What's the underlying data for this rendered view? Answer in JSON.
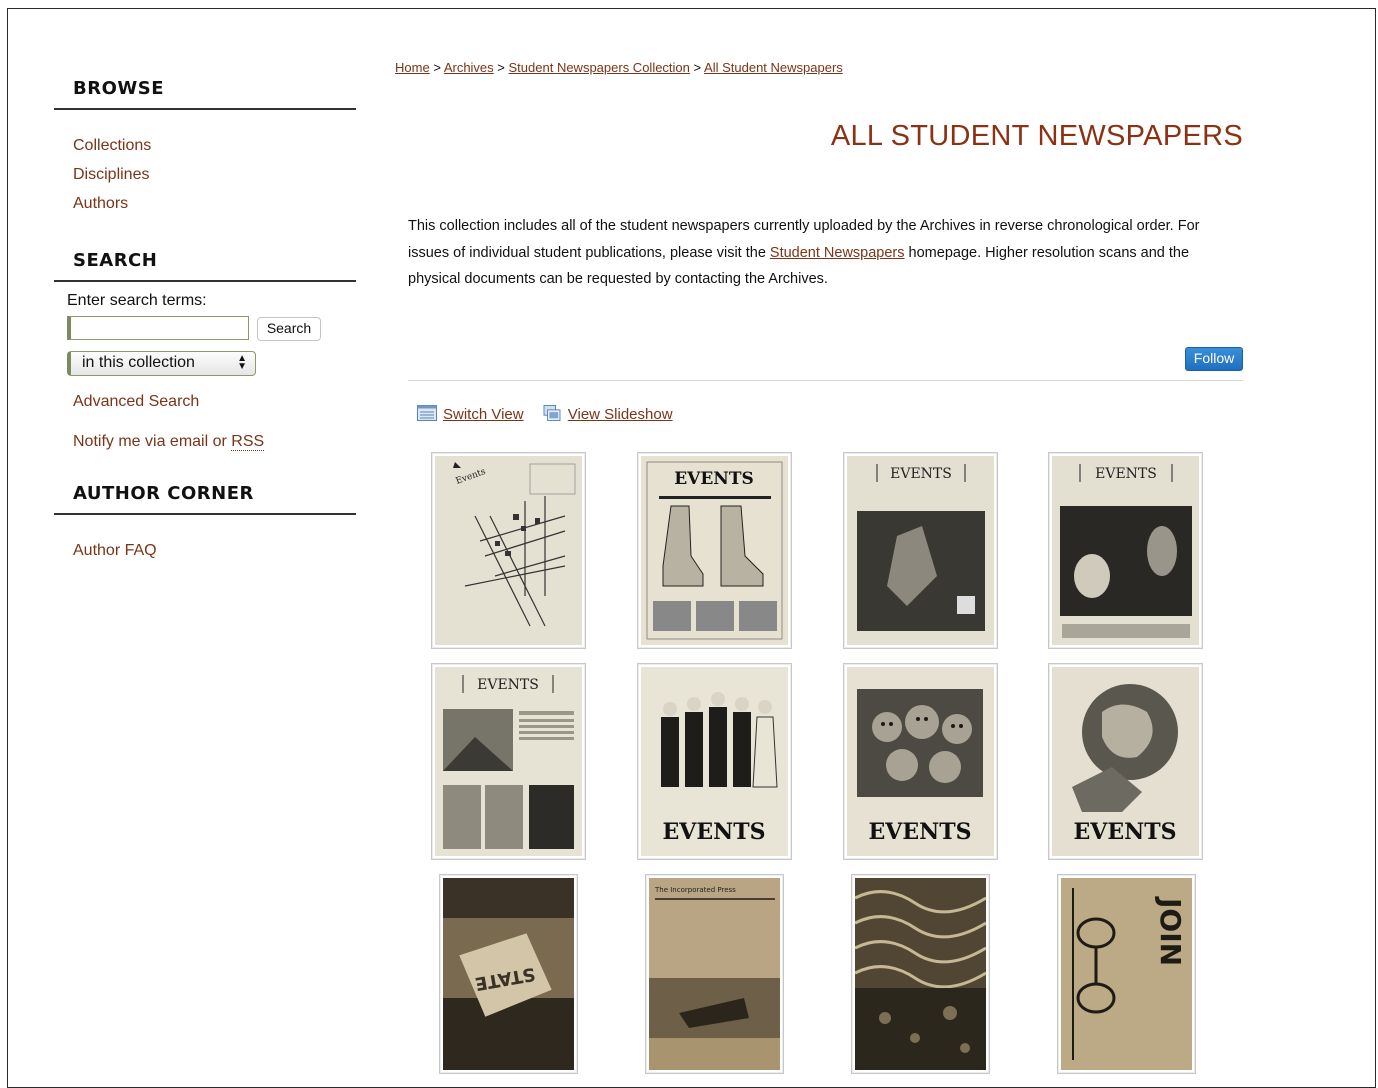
{
  "sidebar": {
    "browse": {
      "heading": "BROWSE",
      "items": [
        {
          "label": "Collections"
        },
        {
          "label": "Disciplines"
        },
        {
          "label": "Authors"
        }
      ]
    },
    "search": {
      "heading": "SEARCH",
      "label": "Enter search terms:",
      "input_value": "",
      "button_label": "Search",
      "scope_selected": "in this collection",
      "advanced_label": "Advanced Search",
      "notify_prefix": "Notify me via email or ",
      "notify_rss": "RSS"
    },
    "author_corner": {
      "heading": "AUTHOR CORNER",
      "items": [
        {
          "label": "Author FAQ"
        }
      ]
    }
  },
  "breadcrumb": {
    "items": [
      "Home",
      "Archives",
      "Student Newspapers Collection",
      "All Student Newspapers"
    ],
    "separator": ">"
  },
  "page_title": "ALL STUDENT NEWSPAPERS",
  "intro": {
    "part1": "This collection includes all of the student newspapers currently uploaded by the Archives in reverse chronological order. For issues of individual student publications, please visit the ",
    "link": "Student Newspapers",
    "part2": " homepage. Higher resolution scans and the physical documents can be requested by contacting the Archives."
  },
  "follow_label": "Follow",
  "view_links": {
    "switch_view": "Switch View",
    "slideshow": "View Slideshow"
  },
  "thumbnails": [
    {
      "icon": "events-map-cover-icon",
      "caption": "Events"
    },
    {
      "icon": "events-boots-cover-icon",
      "caption": "EVENTS"
    },
    {
      "icon": "events-february-march-cover-icon",
      "caption": "EVENTS"
    },
    {
      "icon": "events-february-cover-icon",
      "caption": "EVENTS"
    },
    {
      "icon": "events-january-february-cover-icon",
      "caption": "EVENTS"
    },
    {
      "icon": "events-figures-cover-icon",
      "caption": "EVENTS"
    },
    {
      "icon": "events-faces-cover-icon",
      "caption": "EVENTS"
    },
    {
      "icon": "events-globe-cover-icon",
      "caption": "EVENTS"
    },
    {
      "icon": "state-cover-icon",
      "caption": "STATE"
    },
    {
      "icon": "incorporated-press-cover-icon",
      "caption": "The Incorporated Press"
    },
    {
      "icon": "abstract-pattern-cover-icon",
      "caption": ""
    },
    {
      "icon": "join-risd-cover-icon",
      "caption": "JOIN"
    }
  ],
  "colors": {
    "link": "#7a3418",
    "title": "#8b3214",
    "follow_button": "#1f6fc0"
  }
}
